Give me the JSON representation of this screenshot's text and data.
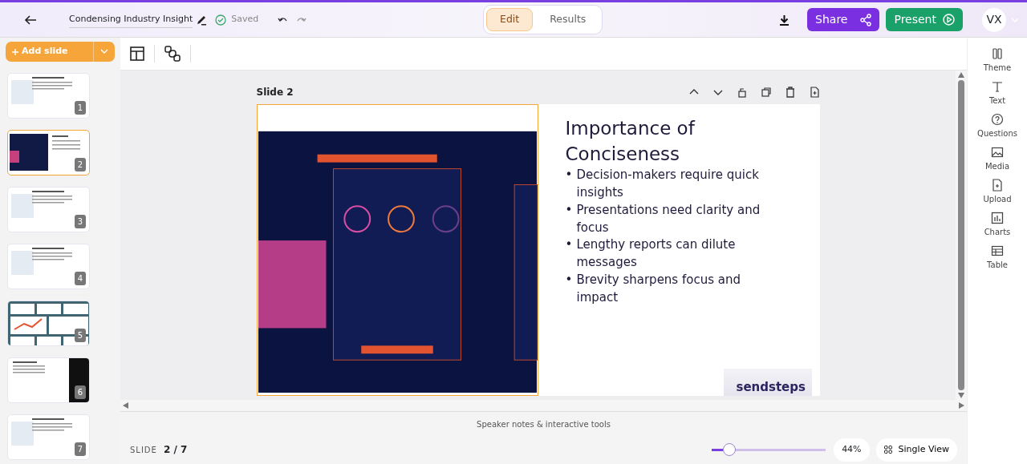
{
  "header": {
    "title": "Condensing Industry Insight",
    "save_status": "Saved",
    "modes": [
      {
        "label": "Edit",
        "selected": true
      },
      {
        "label": "Results",
        "selected": false
      }
    ],
    "share": "Share",
    "present": "Present",
    "avatar": "VX"
  },
  "sidebar": {
    "add_slide": "Add slide",
    "thumbnails": [
      {
        "number": "1",
        "kind": "text",
        "selected": false
      },
      {
        "number": "2",
        "kind": "dark",
        "selected": true
      },
      {
        "number": "3",
        "kind": "text",
        "selected": false
      },
      {
        "number": "4",
        "kind": "text",
        "selected": false
      },
      {
        "number": "5",
        "kind": "collage",
        "selected": false
      },
      {
        "number": "6",
        "kind": "splitdark",
        "selected": false
      },
      {
        "number": "7",
        "kind": "text",
        "selected": false
      }
    ]
  },
  "slide": {
    "label": "Slide 2",
    "title": "Importance of Conciseness",
    "bullet_marker": "•",
    "bullets": [
      "Decision-makers require quick insights",
      "Presentations need clarity and focus",
      "Lengthy reports can dilute messages",
      "Brevity sharpens focus and impact"
    ],
    "logo": "sendsteps"
  },
  "tools": [
    {
      "label": "Theme",
      "kind": "theme"
    },
    {
      "label": "Text",
      "kind": "text"
    },
    {
      "label": "Questions",
      "kind": "questions"
    },
    {
      "label": "Media",
      "kind": "media"
    },
    {
      "label": "Upload",
      "kind": "upload"
    },
    {
      "label": "Charts",
      "kind": "charts"
    },
    {
      "label": "Table",
      "kind": "table"
    }
  ],
  "footer": {
    "notes": "Speaker notes & interactive tools",
    "slide_caption": "SLIDE",
    "slide_position": "2 / 7",
    "zoom": {
      "level": 0.1
    },
    "zoom_reading": "44%",
    "view": "Single View"
  }
}
